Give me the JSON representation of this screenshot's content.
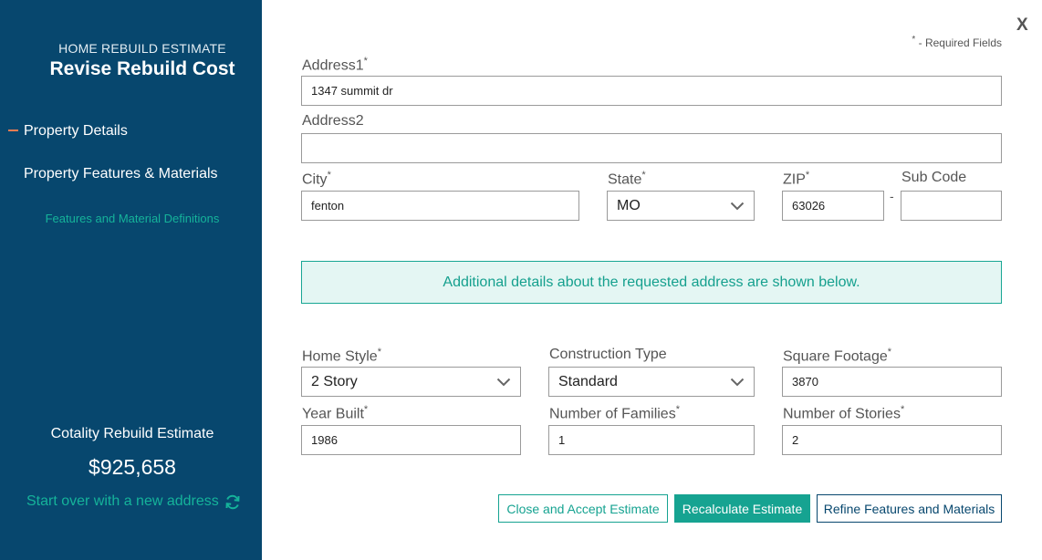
{
  "sidebar": {
    "eyebrow": "HOME REBUILD ESTIMATE",
    "title": "Revise  Rebuild Cost",
    "nav": [
      {
        "label": "Property Details",
        "active": true
      },
      {
        "label": "Property Features & Materials",
        "active": false
      }
    ],
    "definitions_link": "Features and Material Definitions",
    "estimate_label": "Cotality Rebuild Estimate",
    "estimate_value": "$925,658",
    "start_over": "Start over with a new address",
    "start_over_icon": "refresh-icon"
  },
  "close_label": "X",
  "required_note": {
    "star": "*",
    "text": " - Required Fields"
  },
  "form": {
    "address1": {
      "label": "Address1",
      "required": "*",
      "value": "1347 summit dr"
    },
    "address2": {
      "label": "Address2",
      "value": ""
    },
    "city": {
      "label": "City",
      "required": "*",
      "value": "fenton"
    },
    "state": {
      "label": "State",
      "required": "*",
      "value": "MO"
    },
    "zip": {
      "label": "ZIP",
      "required": "*",
      "value": "63026"
    },
    "sub_code": {
      "label": "Sub Code",
      "value": ""
    },
    "zip_separator": "-",
    "info_banner": "Additional details about the requested address are shown below.",
    "home_style": {
      "label": "Home Style",
      "required": "*",
      "value": "2 Story"
    },
    "construction_type": {
      "label": "Construction Type",
      "value": "Standard"
    },
    "square_footage": {
      "label": "Square Footage",
      "required": "*",
      "value": "3870"
    },
    "year_built": {
      "label": "Year Built",
      "required": "*",
      "value": "1986"
    },
    "number_of_families": {
      "label": "Number of Families",
      "required": "*",
      "value": "1"
    },
    "number_of_stories": {
      "label": "Number of Stories",
      "required": "*",
      "value": "2"
    }
  },
  "buttons": {
    "close_accept": "Close and Accept Estimate",
    "recalculate": "Recalculate Estimate",
    "refine": "Refine Features and Materials"
  },
  "colors": {
    "sidebar_bg": "#07476e",
    "accent_teal": "#16a391",
    "active_marker": "#f07c52"
  }
}
